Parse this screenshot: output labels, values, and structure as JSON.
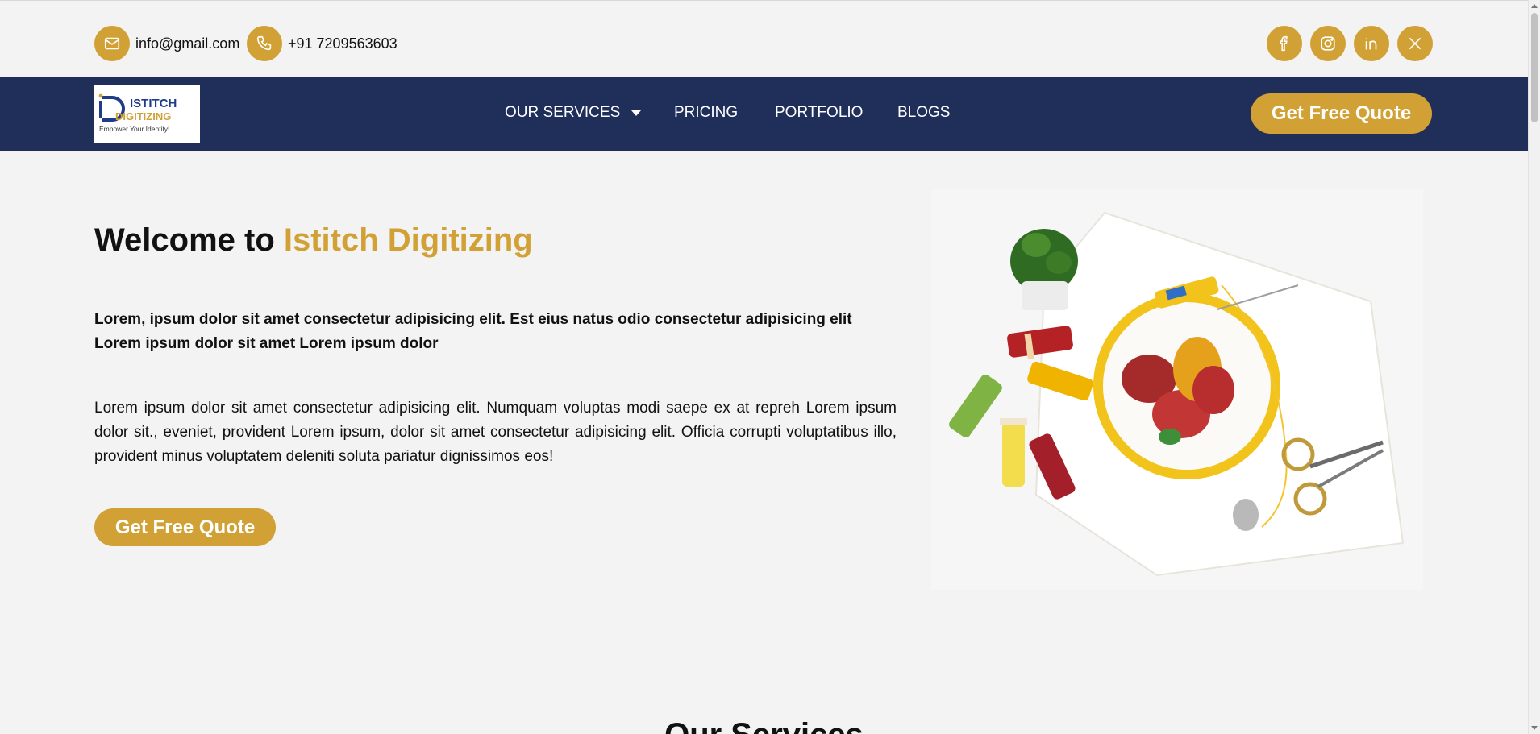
{
  "header": {
    "email": "info@gmail.com",
    "phone": "+91 7209563603",
    "icons": {
      "email": "mail-icon",
      "phone": "phone-icon",
      "facebook": "facebook-icon",
      "instagram": "instagram-icon",
      "linkedin": "linkedin-icon",
      "x": "x-icon"
    }
  },
  "logo": {
    "line1": "ISTITCH",
    "line2": "DIGITIZING",
    "tagline": "Empower Your Identity!"
  },
  "nav": {
    "items": [
      "OUR SERVICES",
      "PRICING",
      "PORTFOLIO",
      "BLOGS"
    ],
    "cta": "Get Free Quote"
  },
  "hero": {
    "title_prefix": "Welcome to",
    "title_accent": "Istitch Digitizing",
    "lead": "Lorem, ipsum dolor sit amet consectetur adipisicing elit. Est eius natus odio consectetur adipisicing elit Lorem ipsum dolor sit amet Lorem ipsum dolor",
    "body": "Lorem ipsum dolor sit amet consectetur adipisicing elit. Numquam voluptas modi saepe ex at repreh Lorem ipsum dolor sit., eveniet, provident Lorem ipsum, dolor sit amet consectetur adipisicing elit. Officia corrupti voluptatibus illo, provident minus voluptatem deleniti soluta pariatur dignissimos eos!",
    "cta": "Get Free Quote"
  },
  "services": {
    "title": "Our Services"
  },
  "colors": {
    "accent": "#d1a136",
    "navy": "#1f2f5a",
    "background": "#f3f3f3"
  }
}
